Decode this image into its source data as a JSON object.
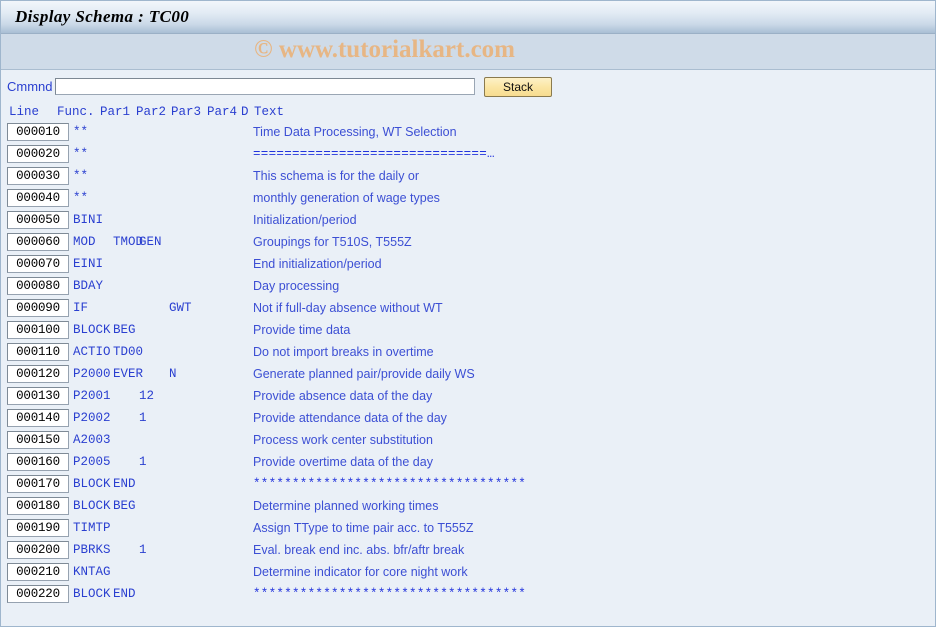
{
  "window": {
    "title": "Display Schema : TC00"
  },
  "watermark": {
    "text": "© www.tutorialkart.com"
  },
  "command_bar": {
    "label": "Cmmnd",
    "input_value": "",
    "input_placeholder": "",
    "stack_button": "Stack"
  },
  "table": {
    "headers": {
      "line": "Line",
      "func": "Func.",
      "par1": "Par1",
      "par2": "Par2",
      "par3": "Par3",
      "par4": "Par4",
      "d": "D",
      "text": "Text"
    },
    "rows": [
      {
        "line": "000010",
        "func": "**",
        "par1": "",
        "par2": "",
        "par3": "",
        "par4": "",
        "d": "",
        "text": "Time Data Processing, WT Selection",
        "text_kind": "text"
      },
      {
        "line": "000020",
        "func": "**",
        "par1": "",
        "par2": "",
        "par3": "",
        "par4": "",
        "d": "",
        "text": "==============================…",
        "text_kind": "symbols"
      },
      {
        "line": "000030",
        "func": "**",
        "par1": "",
        "par2": "",
        "par3": "",
        "par4": "",
        "d": "",
        "text": "This schema is for the daily or",
        "text_kind": "text"
      },
      {
        "line": "000040",
        "func": "**",
        "par1": "",
        "par2": "",
        "par3": "",
        "par4": "",
        "d": "",
        "text": "monthly generation of wage types",
        "text_kind": "text"
      },
      {
        "line": "000050",
        "func": "BINI",
        "par1": "",
        "par2": "",
        "par3": "",
        "par4": "",
        "d": "",
        "text": "Initialization/period",
        "text_kind": "text"
      },
      {
        "line": "000060",
        "func": "MOD",
        "par1": "TMOD",
        "par2": "GEN",
        "par3": "",
        "par4": "",
        "d": "",
        "text": "Groupings for T510S, T555Z",
        "text_kind": "text"
      },
      {
        "line": "000070",
        "func": "EINI",
        "par1": "",
        "par2": "",
        "par3": "",
        "par4": "",
        "d": "",
        "text": "End initialization/period",
        "text_kind": "text"
      },
      {
        "line": "000080",
        "func": "BDAY",
        "par1": "",
        "par2": "",
        "par3": "",
        "par4": "",
        "d": "",
        "text": "Day processing",
        "text_kind": "text"
      },
      {
        "line": "000090",
        "func": "IF",
        "par1": "",
        "par2": "",
        "par3": "GWT",
        "par4": "",
        "d": "",
        "text": "Not if full-day absence without WT",
        "text_kind": "text"
      },
      {
        "line": "000100",
        "func": "BLOCK",
        "par1": "BEG",
        "par2": "",
        "par3": "",
        "par4": "",
        "d": "",
        "text": "Provide time data",
        "text_kind": "text"
      },
      {
        "line": "000110",
        "func": "ACTIO",
        "par1": "TD00",
        "par2": "",
        "par3": "",
        "par4": "",
        "d": "",
        "text": "Do not import breaks in overtime",
        "text_kind": "text"
      },
      {
        "line": "000120",
        "func": "P2000",
        "par1": "EVER",
        "par2": "",
        "par3": "N",
        "par4": "",
        "d": "",
        "text": "Generate planned pair/provide daily WS",
        "text_kind": "text"
      },
      {
        "line": "000130",
        "func": "P2001",
        "par1": "",
        "par2": "12",
        "par3": "",
        "par4": "",
        "d": "",
        "text": "Provide absence data of the day",
        "text_kind": "text"
      },
      {
        "line": "000140",
        "func": "P2002",
        "par1": "",
        "par2": "1",
        "par3": "",
        "par4": "",
        "d": "",
        "text": "Provide attendance data of the day",
        "text_kind": "text"
      },
      {
        "line": "000150",
        "func": "A2003",
        "par1": "",
        "par2": "",
        "par3": "",
        "par4": "",
        "d": "",
        "text": "Process work center substitution",
        "text_kind": "text"
      },
      {
        "line": "000160",
        "func": "P2005",
        "par1": "",
        "par2": "1",
        "par3": "",
        "par4": "",
        "d": "",
        "text": "Provide overtime data of the day",
        "text_kind": "text"
      },
      {
        "line": "000170",
        "func": "BLOCK",
        "par1": "END",
        "par2": "",
        "par3": "",
        "par4": "",
        "d": "",
        "text": "***********************************",
        "text_kind": "symbols"
      },
      {
        "line": "000180",
        "func": "BLOCK",
        "par1": "BEG",
        "par2": "",
        "par3": "",
        "par4": "",
        "d": "",
        "text": "Determine planned working times",
        "text_kind": "text"
      },
      {
        "line": "000190",
        "func": "TIMTP",
        "par1": "",
        "par2": "",
        "par3": "",
        "par4": "",
        "d": "",
        "text": "Assign TType to time pair acc. to T555Z",
        "text_kind": "text"
      },
      {
        "line": "000200",
        "func": "PBRKS",
        "par1": "",
        "par2": "1",
        "par3": "",
        "par4": "",
        "d": "",
        "text": "Eval. break end inc. abs. bfr/aftr break",
        "text_kind": "text"
      },
      {
        "line": "000210",
        "func": "KNTAG",
        "par1": "",
        "par2": "",
        "par3": "",
        "par4": "",
        "d": "",
        "text": "Determine indicator for core night work",
        "text_kind": "text"
      },
      {
        "line": "000220",
        "func": "BLOCK",
        "par1": "END",
        "par2": "",
        "par3": "",
        "par4": "",
        "d": "",
        "text": "***********************************",
        "text_kind": "symbols"
      }
    ]
  },
  "colors": {
    "title_bar_top": "#f2f6fb",
    "title_bar_bottom": "#a9bed4",
    "watermark_band": "#cfdbe8",
    "page_background": "#eaf0f7",
    "text_blue": "#2a3fd0",
    "watermark_orange": "#e7b684",
    "button_yellow": "#fbe6a4"
  }
}
